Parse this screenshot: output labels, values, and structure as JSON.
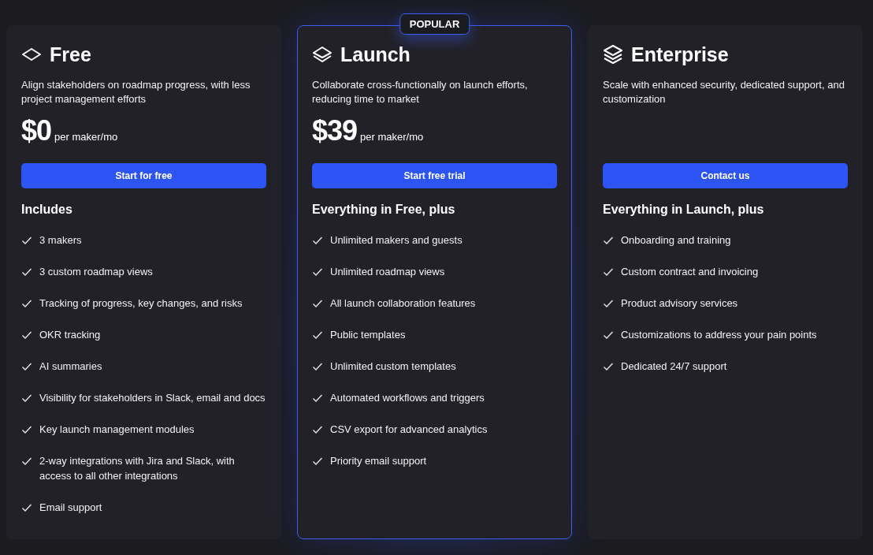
{
  "plans": [
    {
      "name": "Free",
      "kind": "diamond",
      "featured": false,
      "description": "Align stakeholders on roadmap progress, with less project management efforts",
      "price": "$0",
      "price_unit": "per maker/mo",
      "button": "Start for free",
      "features_heading": "Includes",
      "features": [
        "3 makers",
        "3 custom roadmap views",
        "Tracking of progress, key changes, and risks",
        "OKR tracking",
        "AI summaries",
        "Visibility for stakeholders in Slack, email and docs",
        "Key launch management modules",
        "2-way integrations with Jira and Slack, with access to all other integrations",
        "Email support"
      ]
    },
    {
      "name": "Launch",
      "kind": "layers2",
      "featured": true,
      "badge": "POPULAR",
      "description": "Collaborate cross-functionally on launch efforts, reducing time to market",
      "price": "$39",
      "price_unit": "per maker/mo",
      "button": "Start free trial",
      "features_heading": "Everything in Free, plus",
      "features": [
        "Unlimited makers and guests",
        "Unlimited roadmap views",
        "All launch collaboration features",
        "Public templates",
        "Unlimited custom templates",
        "Automated workflows and triggers",
        "CSV export for advanced analytics",
        "Priority email support"
      ]
    },
    {
      "name": "Enterprise",
      "kind": "layers3",
      "featured": false,
      "description": "Scale with enhanced security, dedicated support, and customization",
      "button": "Contact us",
      "features_heading": "Everything in Launch, plus",
      "features": [
        "Onboarding and training",
        "Custom contract and invoicing",
        "Product advisory services",
        "Customizations to address your pain points",
        "Dedicated 24/7 support"
      ]
    }
  ]
}
